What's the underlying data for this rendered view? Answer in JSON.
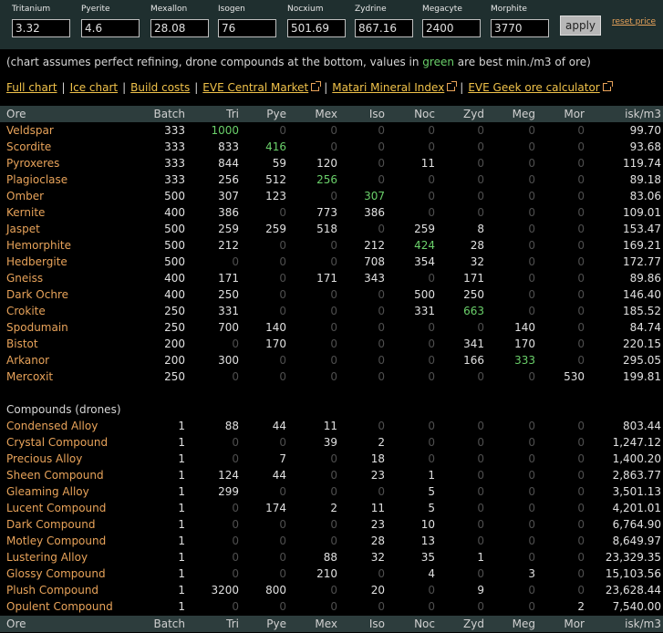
{
  "top": {
    "minerals": [
      {
        "label": "Tritanium",
        "value": "3.32"
      },
      {
        "label": "Pyerite",
        "value": "4.6"
      },
      {
        "label": "Mexallon",
        "value": "28.08"
      },
      {
        "label": "Isogen",
        "value": "76"
      },
      {
        "label": "Nocxium",
        "value": "501.69"
      },
      {
        "label": "Zydrine",
        "value": "867.16"
      },
      {
        "label": "Megacyte",
        "value": "2400"
      },
      {
        "label": "Morphite",
        "value": "3770"
      }
    ],
    "apply_label": "apply",
    "reset_label": "reset price"
  },
  "note": {
    "before": "(chart assumes perfect refining, drone compounds at the bottom, values in ",
    "green_word": "green",
    "after": " are best min./m3 of ore)"
  },
  "links": [
    {
      "label": "Full chart",
      "external": false
    },
    {
      "label": "Ice chart",
      "external": false
    },
    {
      "label": "Build costs",
      "external": false
    },
    {
      "label": "EVE Central Market",
      "external": true
    },
    {
      "label": "Matari Mineral Index",
      "external": true
    },
    {
      "label": "EVE Geek ore calculator",
      "external": true
    }
  ],
  "columns": [
    "Ore",
    "Batch",
    "Tri",
    "Pye",
    "Mex",
    "Iso",
    "Noc",
    "Zyd",
    "Meg",
    "Mor",
    "isk/m3"
  ],
  "ores": [
    {
      "name": "Veldspar",
      "values": [
        "333",
        "1000",
        "0",
        "0",
        "0",
        "0",
        "0",
        "0",
        "0",
        "99.70"
      ],
      "best": [
        1
      ]
    },
    {
      "name": "Scordite",
      "values": [
        "333",
        "833",
        "416",
        "0",
        "0",
        "0",
        "0",
        "0",
        "0",
        "93.68"
      ],
      "best": [
        2
      ]
    },
    {
      "name": "Pyroxeres",
      "values": [
        "333",
        "844",
        "59",
        "120",
        "0",
        "11",
        "0",
        "0",
        "0",
        "119.74"
      ],
      "best": []
    },
    {
      "name": "Plagioclase",
      "values": [
        "333",
        "256",
        "512",
        "256",
        "0",
        "0",
        "0",
        "0",
        "0",
        "89.18"
      ],
      "best": [
        3
      ]
    },
    {
      "name": "Omber",
      "values": [
        "500",
        "307",
        "123",
        "0",
        "307",
        "0",
        "0",
        "0",
        "0",
        "83.06"
      ],
      "best": [
        4
      ]
    },
    {
      "name": "Kernite",
      "values": [
        "400",
        "386",
        "0",
        "773",
        "386",
        "0",
        "0",
        "0",
        "0",
        "109.01"
      ],
      "best": []
    },
    {
      "name": "Jaspet",
      "values": [
        "500",
        "259",
        "259",
        "518",
        "0",
        "259",
        "8",
        "0",
        "0",
        "153.47"
      ],
      "best": []
    },
    {
      "name": "Hemorphite",
      "values": [
        "500",
        "212",
        "0",
        "0",
        "212",
        "424",
        "28",
        "0",
        "0",
        "169.21"
      ],
      "best": [
        5
      ]
    },
    {
      "name": "Hedbergite",
      "values": [
        "500",
        "0",
        "0",
        "0",
        "708",
        "354",
        "32",
        "0",
        "0",
        "172.77"
      ],
      "best": []
    },
    {
      "name": "Gneiss",
      "values": [
        "400",
        "171",
        "0",
        "171",
        "343",
        "0",
        "171",
        "0",
        "0",
        "89.86"
      ],
      "best": []
    },
    {
      "name": "Dark Ochre",
      "values": [
        "400",
        "250",
        "0",
        "0",
        "0",
        "500",
        "250",
        "0",
        "0",
        "146.40"
      ],
      "best": []
    },
    {
      "name": "Crokite",
      "values": [
        "250",
        "331",
        "0",
        "0",
        "0",
        "331",
        "663",
        "0",
        "0",
        "185.52"
      ],
      "best": [
        6
      ]
    },
    {
      "name": "Spodumain",
      "values": [
        "250",
        "700",
        "140",
        "0",
        "0",
        "0",
        "0",
        "140",
        "0",
        "84.74"
      ],
      "best": []
    },
    {
      "name": "Bistot",
      "values": [
        "200",
        "0",
        "170",
        "0",
        "0",
        "0",
        "341",
        "170",
        "0",
        "220.15"
      ],
      "best": []
    },
    {
      "name": "Arkanor",
      "values": [
        "200",
        "300",
        "0",
        "0",
        "0",
        "0",
        "166",
        "333",
        "0",
        "295.05"
      ],
      "best": [
        7
      ]
    },
    {
      "name": "Mercoxit",
      "values": [
        "250",
        "0",
        "0",
        "0",
        "0",
        "0",
        "0",
        "0",
        "530",
        "199.81"
      ],
      "best": []
    }
  ],
  "compounds_title": "Compounds (drones)",
  "compounds": [
    {
      "name": "Condensed Alloy",
      "values": [
        "1",
        "88",
        "44",
        "11",
        "0",
        "0",
        "0",
        "0",
        "0",
        "803.44"
      ]
    },
    {
      "name": "Crystal Compound",
      "values": [
        "1",
        "0",
        "0",
        "39",
        "2",
        "0",
        "0",
        "0",
        "0",
        "1,247.12"
      ]
    },
    {
      "name": "Precious Alloy",
      "values": [
        "1",
        "0",
        "7",
        "0",
        "18",
        "0",
        "0",
        "0",
        "0",
        "1,400.20"
      ]
    },
    {
      "name": "Sheen Compound",
      "values": [
        "1",
        "124",
        "44",
        "0",
        "23",
        "1",
        "0",
        "0",
        "0",
        "2,863.77"
      ]
    },
    {
      "name": "Gleaming Alloy",
      "values": [
        "1",
        "299",
        "0",
        "0",
        "0",
        "5",
        "0",
        "0",
        "0",
        "3,501.13"
      ]
    },
    {
      "name": "Lucent Compound",
      "values": [
        "1",
        "0",
        "174",
        "2",
        "11",
        "5",
        "0",
        "0",
        "0",
        "4,201.01"
      ]
    },
    {
      "name": "Dark Compound",
      "values": [
        "1",
        "0",
        "0",
        "0",
        "23",
        "10",
        "0",
        "0",
        "0",
        "6,764.90"
      ]
    },
    {
      "name": "Motley Compound",
      "values": [
        "1",
        "0",
        "0",
        "0",
        "28",
        "13",
        "0",
        "0",
        "0",
        "8,649.97"
      ]
    },
    {
      "name": "Lustering Alloy",
      "values": [
        "1",
        "0",
        "0",
        "88",
        "32",
        "35",
        "1",
        "0",
        "0",
        "23,329.35"
      ]
    },
    {
      "name": "Glossy Compound",
      "values": [
        "1",
        "0",
        "0",
        "210",
        "0",
        "4",
        "0",
        "3",
        "0",
        "15,103.56"
      ]
    },
    {
      "name": "Plush Compound",
      "values": [
        "1",
        "3200",
        "800",
        "0",
        "20",
        "0",
        "9",
        "0",
        "0",
        "23,628.44"
      ]
    },
    {
      "name": "Opulent Compound",
      "values": [
        "1",
        "0",
        "0",
        "0",
        "0",
        "0",
        "0",
        "0",
        "2",
        "7,540.00"
      ]
    }
  ]
}
